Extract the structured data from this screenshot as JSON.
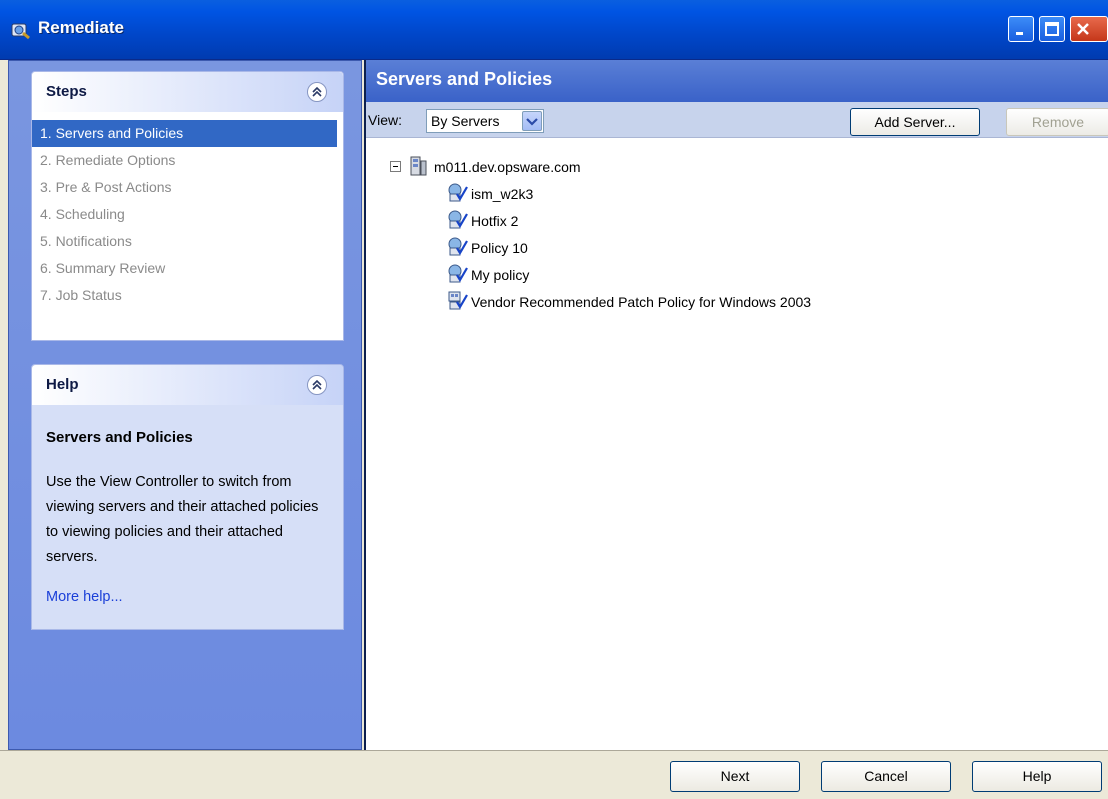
{
  "window": {
    "title": "Remediate",
    "icon": "remediate-app-icon"
  },
  "steps_panel": {
    "title": "Steps",
    "items": [
      {
        "label": "1. Servers and Policies",
        "active": true
      },
      {
        "label": "2. Remediate Options",
        "active": false
      },
      {
        "label": "3. Pre & Post Actions",
        "active": false
      },
      {
        "label": "4. Scheduling",
        "active": false
      },
      {
        "label": "5. Notifications",
        "active": false
      },
      {
        "label": "6. Summary Review",
        "active": false
      },
      {
        "label": "7. Job Status",
        "active": false
      }
    ]
  },
  "help_panel": {
    "title": "Help",
    "heading": "Servers and Policies",
    "text": "Use the View Controller to switch from viewing servers and their attached policies to viewing policies and their attached servers.",
    "link": "More help..."
  },
  "main": {
    "title": "Servers and Policies",
    "view_label": "View:",
    "view_value": "By Servers",
    "add_server_label": "Add Server...",
    "remove_label": "Remove",
    "tree": {
      "server": "m011.dev.opsware.com",
      "policies": [
        {
          "label": "ism_w2k3",
          "icon": "policy-icon"
        },
        {
          "label": "Hotfix 2",
          "icon": "policy-icon"
        },
        {
          "label": "Policy 10",
          "icon": "policy-icon"
        },
        {
          "label": "My policy",
          "icon": "policy-icon"
        },
        {
          "label": "Vendor Recommended Patch Policy for Windows 2003",
          "icon": "vendor-policy-icon"
        }
      ]
    }
  },
  "footer": {
    "next_label": "Next",
    "cancel_label": "Cancel",
    "help_label": "Help"
  },
  "colors": {
    "titlebar": "#0054e3",
    "left_pane": "#6c8ae0",
    "active_step": "#3168c5",
    "header_blue": "#3a62c8",
    "link": "#1a3fd8"
  }
}
